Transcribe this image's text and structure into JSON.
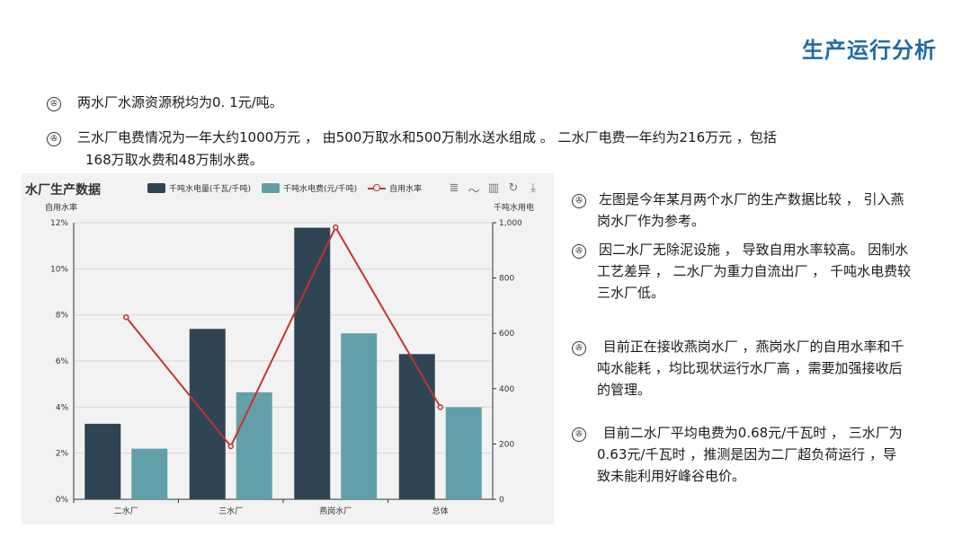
{
  "page": {
    "title": "生产运行分析"
  },
  "bullets_top": [
    {
      "icon": "circle-mark-icon",
      "lines": [
        "两水厂水源资源税均为0. 1元/吨。"
      ]
    },
    {
      "icon": "circle-mark-icon",
      "lines": [
        "三水厂电费情况为一年大约1000万元 ，  由500万取水和500万制水送水组成 。 二水厂电费一年约为216万元   ，包括",
        "168万取水费和48万制水费。"
      ]
    }
  ],
  "side_bullets": [
    {
      "first": "左图是今年某月两个水厂的生产数据比较 ，  引入燕",
      "rest": [
        "岗水厂作为参考。"
      ]
    },
    {
      "first": "因二水厂无除泥设施  ， 导致自用水率较高。 因制水",
      "rest": [
        "工艺差异 ，  二水厂为重力自流出厂 ，  千吨水电费较",
        "三水厂低。"
      ]
    },
    {
      "first": " 目前正在接收燕岗水厂  ，燕岗水厂的自用水率和千",
      "rest": [
        "吨水能耗  ，均比现状运行水厂高  ，需要加强接收后",
        "的管理。"
      ]
    },
    {
      "first": " 目前二水厂平均电费为0.68元/千瓦时 ，  三水厂为",
      "rest": [
        "0.63元/千瓦时   ，推测是因为二厂超负荷运行   ，导",
        "致未能利用好峰谷电价。"
      ]
    }
  ],
  "toolbox": [
    "≣",
    "〜",
    "▥",
    "↻",
    "⤓"
  ],
  "chart_data": {
    "type": "bar",
    "title": "水厂生产数据",
    "categories": [
      "二水厂",
      "三水厂",
      "燕岗水厂",
      "总体"
    ],
    "series": [
      {
        "name": "千吨水电量(千瓦/千吨)",
        "type": "bar",
        "axis": "right",
        "color": "#2f4554",
        "values": [
          273,
          616,
          982,
          525
        ]
      },
      {
        "name": "千吨水电费(元/千吨)",
        "type": "bar",
        "axis": "right",
        "color": "#61a0a8",
        "values": [
          183,
          387,
          600,
          333
        ]
      },
      {
        "name": "自用水率",
        "type": "line",
        "axis": "left",
        "color": "#c23531",
        "values": [
          7.9,
          2.3,
          11.8,
          4.0
        ]
      }
    ],
    "y_left": {
      "name": "自用水率",
      "min": 0,
      "max": 12,
      "ticks": [
        "0%",
        "2%",
        "4%",
        "6%",
        "8%",
        "10%",
        "12%"
      ]
    },
    "y_right": {
      "name": "千吨水用电",
      "min": 0,
      "max": 1000,
      "ticks": [
        "0",
        "200",
        "400",
        "600",
        "800",
        "1,000"
      ]
    },
    "legend_position": "top",
    "grid": true
  }
}
